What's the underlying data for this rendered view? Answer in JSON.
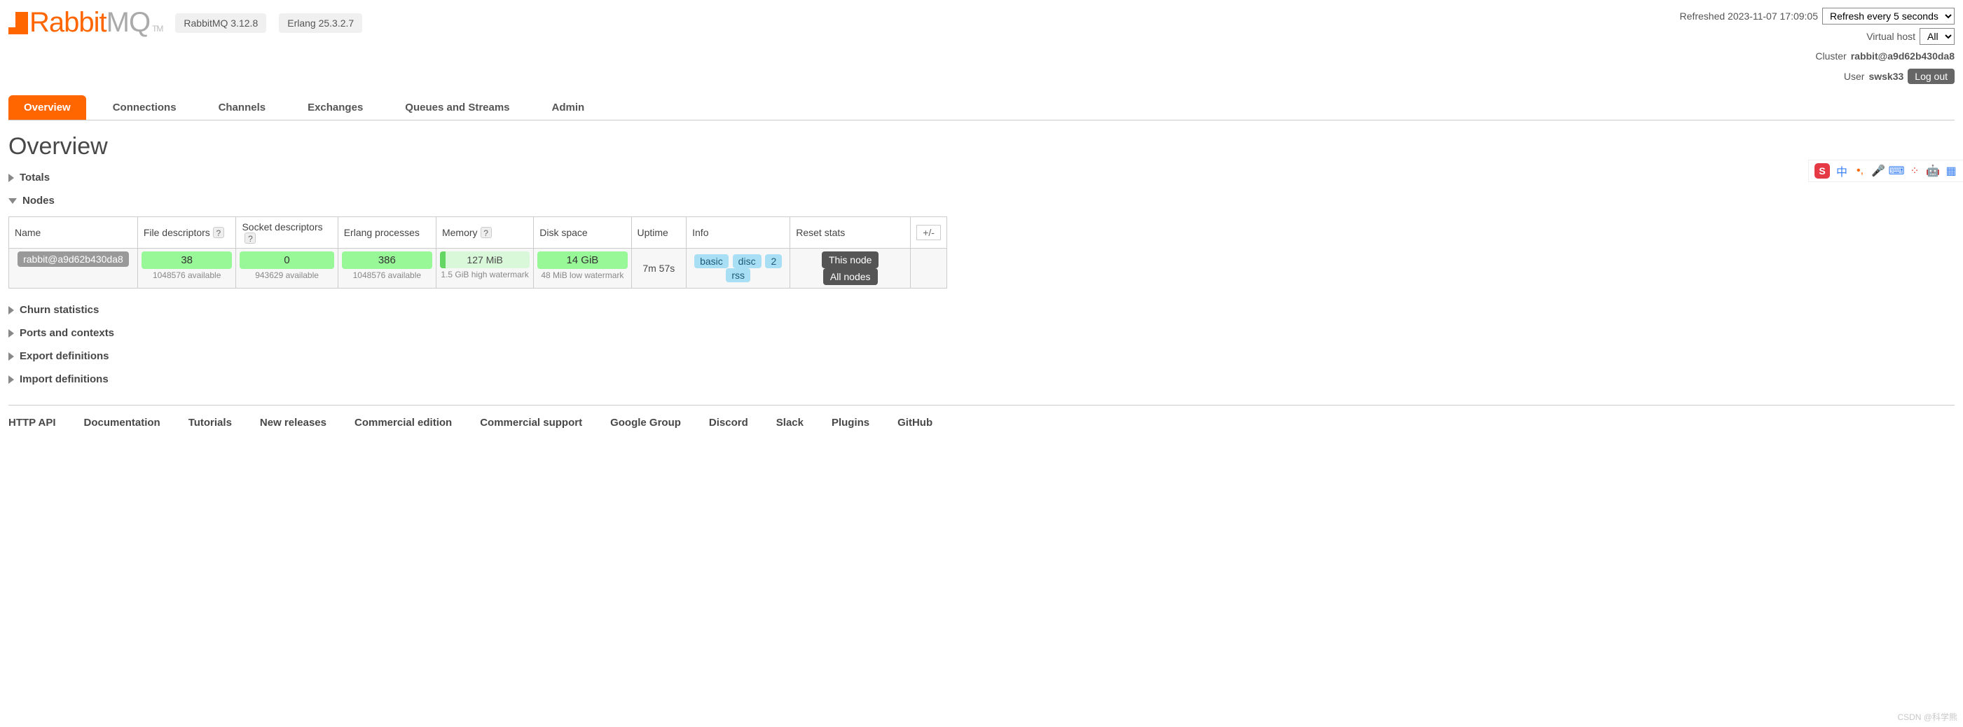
{
  "brand": {
    "name1": "Rabbit",
    "name2": "MQ",
    "tm": "TM"
  },
  "versions": {
    "rabbitmq": "RabbitMQ 3.12.8",
    "erlang": "Erlang 25.3.2.7"
  },
  "status": {
    "refreshed": "Refreshed 2023-11-07 17:09:05",
    "refresh_select": "Refresh every 5 seconds",
    "vhost_label": "Virtual host",
    "vhost_value": "All",
    "cluster_label": "Cluster ",
    "cluster_value": "rabbit@a9d62b430da8",
    "user_label": "User ",
    "user_value": "swsk33",
    "logout": "Log out"
  },
  "tabs": [
    "Overview",
    "Connections",
    "Channels",
    "Exchanges",
    "Queues and Streams",
    "Admin"
  ],
  "page_title": "Overview",
  "sections": {
    "totals": "Totals",
    "nodes": "Nodes",
    "churn": "Churn statistics",
    "ports": "Ports and contexts",
    "export": "Export definitions",
    "import": "Import definitions"
  },
  "nodes_table": {
    "headers": {
      "name": "Name",
      "fd": "File descriptors",
      "sd": "Socket descriptors",
      "ep": "Erlang processes",
      "mem": "Memory",
      "disk": "Disk space",
      "uptime": "Uptime",
      "info": "Info",
      "reset": "Reset stats",
      "pm": "+/-"
    },
    "row": {
      "name": "rabbit@a9d62b430da8",
      "fd": "38",
      "fd_sub": "1048576 available",
      "sd": "0",
      "sd_sub": "943629 available",
      "ep": "386",
      "ep_sub": "1048576 available",
      "mem": "127 MiB",
      "mem_sub": "1.5 GiB high watermark",
      "disk": "14 GiB",
      "disk_sub": "48 MiB low watermark",
      "uptime": "7m 57s",
      "info": [
        "basic",
        "disc",
        "2",
        "rss"
      ],
      "reset": [
        "This node",
        "All nodes"
      ]
    }
  },
  "footer": [
    "HTTP API",
    "Documentation",
    "Tutorials",
    "New releases",
    "Commercial edition",
    "Commercial support",
    "Google Group",
    "Discord",
    "Slack",
    "Plugins",
    "GitHub"
  ],
  "watermark": "CSDN @科学熊"
}
